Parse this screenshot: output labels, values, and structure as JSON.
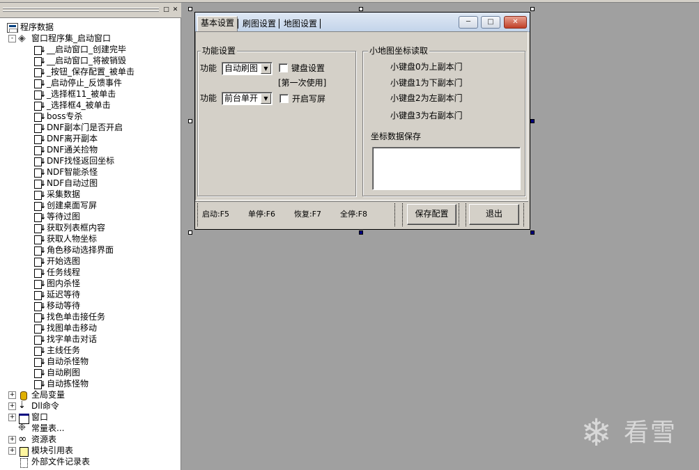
{
  "tree": {
    "root_label": "程序数据",
    "window_set_label": "窗口程序集_启动窗口",
    "subroutines": [
      "__启动窗口_创建完毕",
      "__启动窗口_将被销毁",
      "_按钮_保存配置_被单击",
      "_启动停止_反馈事件",
      "_选择框11_被单击",
      "_选择框4_被单击",
      "boss专杀",
      "DNF副本门是否开启",
      "DNF离开副本",
      "DNF通关捡物",
      "DNF找怪返回坐标",
      "NDF智能杀怪",
      "NDF自动过图",
      "采集数据",
      "创建桌面写屏",
      "等待过图",
      "获取列表框内容",
      "获取人物坐标",
      "角色移动选择界面",
      "开始选图",
      "任务线程",
      "图内杀怪",
      "延迟等待",
      "移动等待",
      "找色单击接任务",
      "找图单击移动",
      "找字单击对话",
      "主线任务",
      "自动杀怪物",
      "自动刷图",
      "自动拣怪物"
    ],
    "bottom_items": [
      {
        "label": "全局变量",
        "icon": "database-icon",
        "expand": "+"
      },
      {
        "label": "Dll命令",
        "icon": "dll-icon",
        "expand": "+"
      },
      {
        "label": "窗口",
        "icon": "window-icon",
        "expand": "+"
      },
      {
        "label": "常量表...",
        "icon": "constant-icon",
        "expand": ""
      },
      {
        "label": "资源表",
        "icon": "resource-icon",
        "expand": "+"
      },
      {
        "label": "模块引用表",
        "icon": "module-icon",
        "expand": "+"
      },
      {
        "label": "外部文件记录表",
        "icon": "file-icon",
        "expand": ""
      }
    ]
  },
  "form": {
    "tabs": [
      "基本设置",
      "刷图设置",
      "地图设置"
    ],
    "function_group": {
      "title": "功能设置",
      "row1_label": "功能",
      "row1_combo": "自动刷图",
      "row1_checkbox": "键盘设置",
      "row1_note": "[第一次使用]",
      "row2_label": "功能",
      "row2_combo": "前台单开",
      "row2_checkbox": "开启写屏"
    },
    "minimap_group": {
      "title": "小地图坐标读取",
      "lines": [
        "小键盘0为上副本门",
        "小键盘1为下副本门",
        "小键盘2为左副本门",
        "小键盘3为右副本门"
      ],
      "save_label": "坐标数据保存"
    },
    "hotkeys": {
      "start": "启动:F5",
      "single_stop": "单停:F6",
      "resume": "恢复:F7",
      "all_stop": "全停:F8"
    },
    "buttons": {
      "save": "保存配置",
      "exit": "退出"
    }
  },
  "watermark": "看雪"
}
